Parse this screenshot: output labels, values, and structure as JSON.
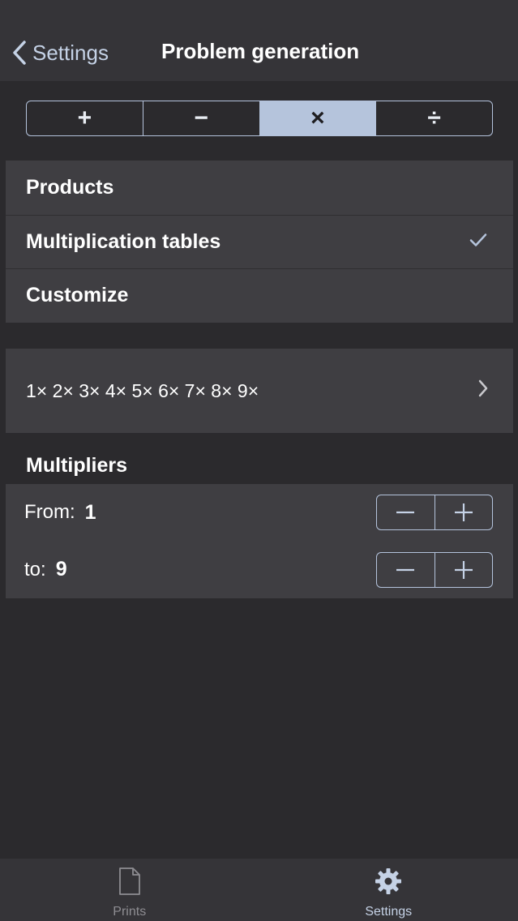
{
  "navbar": {
    "back_label": "Settings",
    "title": "Problem generation"
  },
  "operations": {
    "segments": [
      "+",
      "−",
      "×",
      "÷"
    ],
    "selected": "×"
  },
  "mode_options": {
    "items": [
      "Products",
      "Multiplication tables",
      "Customize"
    ],
    "checked": "Multiplication tables"
  },
  "tables": {
    "summary": "1× 2× 3× 4× 5× 6× 7× 8× 9×"
  },
  "multipliers": {
    "header": "Multipliers",
    "from_label": "From:",
    "from_value": "1",
    "to_label": "to:",
    "to_value": "9"
  },
  "tabbar": {
    "prints_label": "Prints",
    "settings_label": "Settings",
    "active": "Settings"
  },
  "colors": {
    "accent": "#b5c4dc",
    "background": "#2b2a2d",
    "cell": "#3f3e42",
    "bar": "#353438"
  },
  "icons": {
    "back": "chevron-left-icon",
    "check": "checkmark-icon",
    "disclosure": "chevron-right-icon",
    "prints": "document-icon",
    "settings": "gear-icon"
  }
}
